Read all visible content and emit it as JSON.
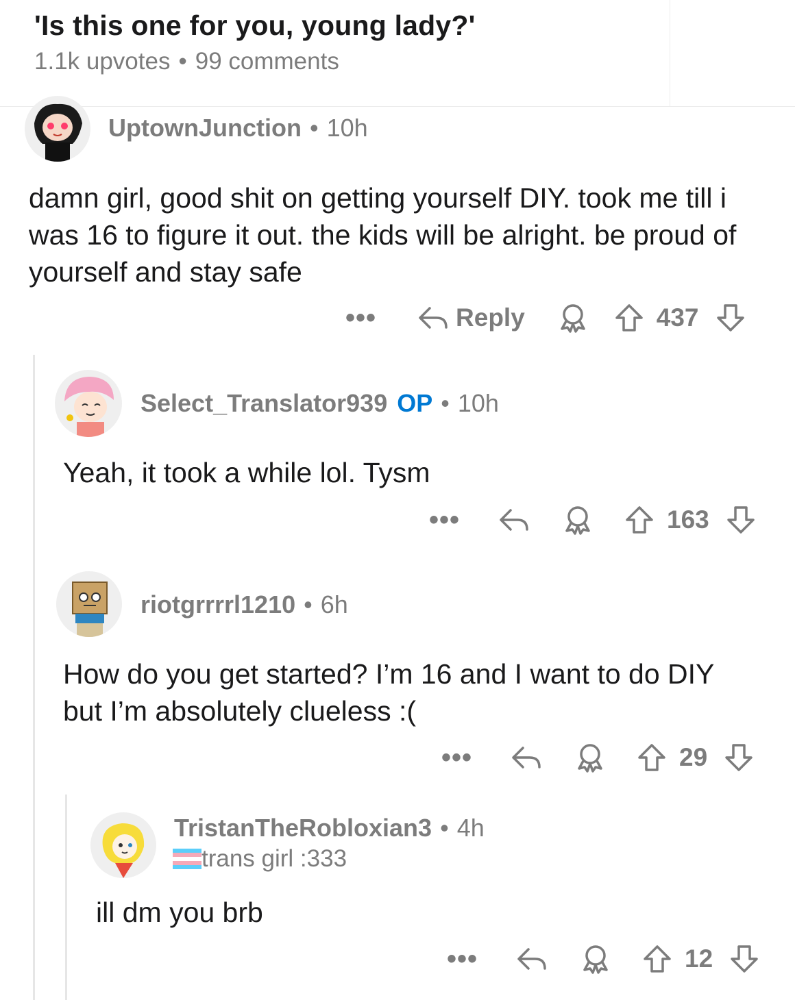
{
  "post": {
    "title": "'Is this one for you, young lady?'",
    "upvotes": "1.1k upvotes",
    "comments": "99 comments",
    "separator": "•"
  },
  "comments": [
    {
      "username": "UptownJunction",
      "age": "10h",
      "body": "damn girl, good shit on getting yourself DIY. took me till i was 16 to figure it out. the kids will be alright. be proud of yourself and stay safe",
      "reply_label": "Reply",
      "votes": "437",
      "more": "•••"
    },
    {
      "username": "Select_Translator939",
      "op_badge": "OP",
      "age": "10h",
      "body": "Yeah, it took a while lol. Tysm",
      "votes": "163",
      "more": "•••"
    },
    {
      "username": "riotgrrrrl1210",
      "age": "6h",
      "body": "How do you get started? I’m 16 and I want to do DIY but I’m absolutely clueless :(",
      "votes": "29",
      "more": "•••"
    },
    {
      "username": "TristanTheRobloxian3",
      "age": "4h",
      "flair": "trans girl :333",
      "body": "ill dm you brb",
      "votes": "12",
      "more": "•••"
    }
  ],
  "icons": {
    "reply": "reply-arrow-icon",
    "award": "award-icon",
    "upvote": "upvote-arrow-icon",
    "downvote": "downvote-arrow-icon",
    "flair_flag": "trans-flag-icon"
  },
  "colors": {
    "op": "#0079d3",
    "meta": "#7c7c7c",
    "text": "#1a1a1b"
  }
}
